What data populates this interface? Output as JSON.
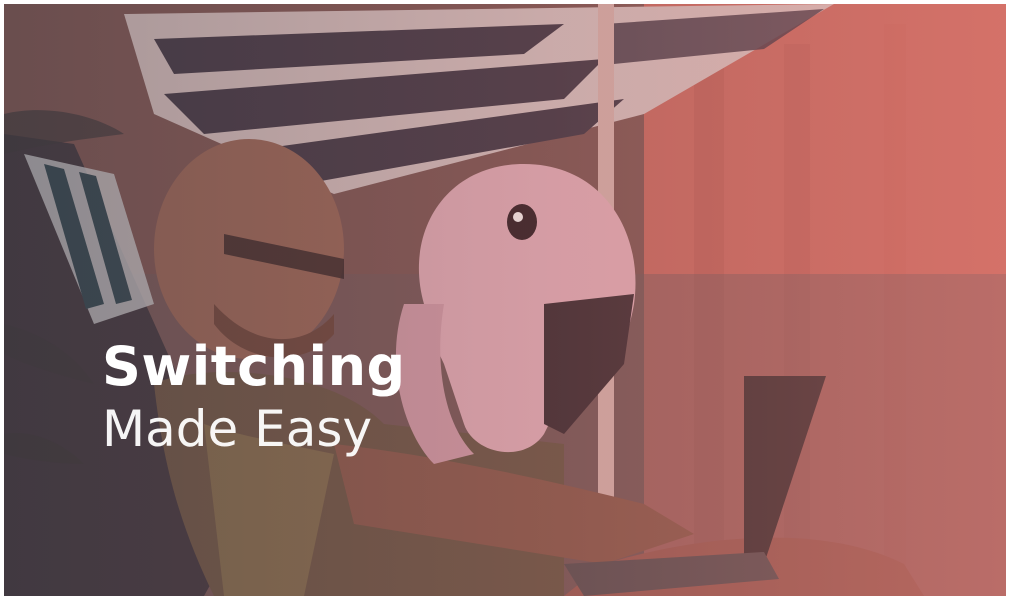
{
  "hero": {
    "title_bold": "Switching",
    "title_light": "Made Easy",
    "image_alt": "man-in-deck-chair-with-laptop-and-flamingo-float"
  },
  "colors": {
    "overlay_left": "#4a3c3d",
    "overlay_right": "#d9736b",
    "headline_text": "#ffffff"
  }
}
